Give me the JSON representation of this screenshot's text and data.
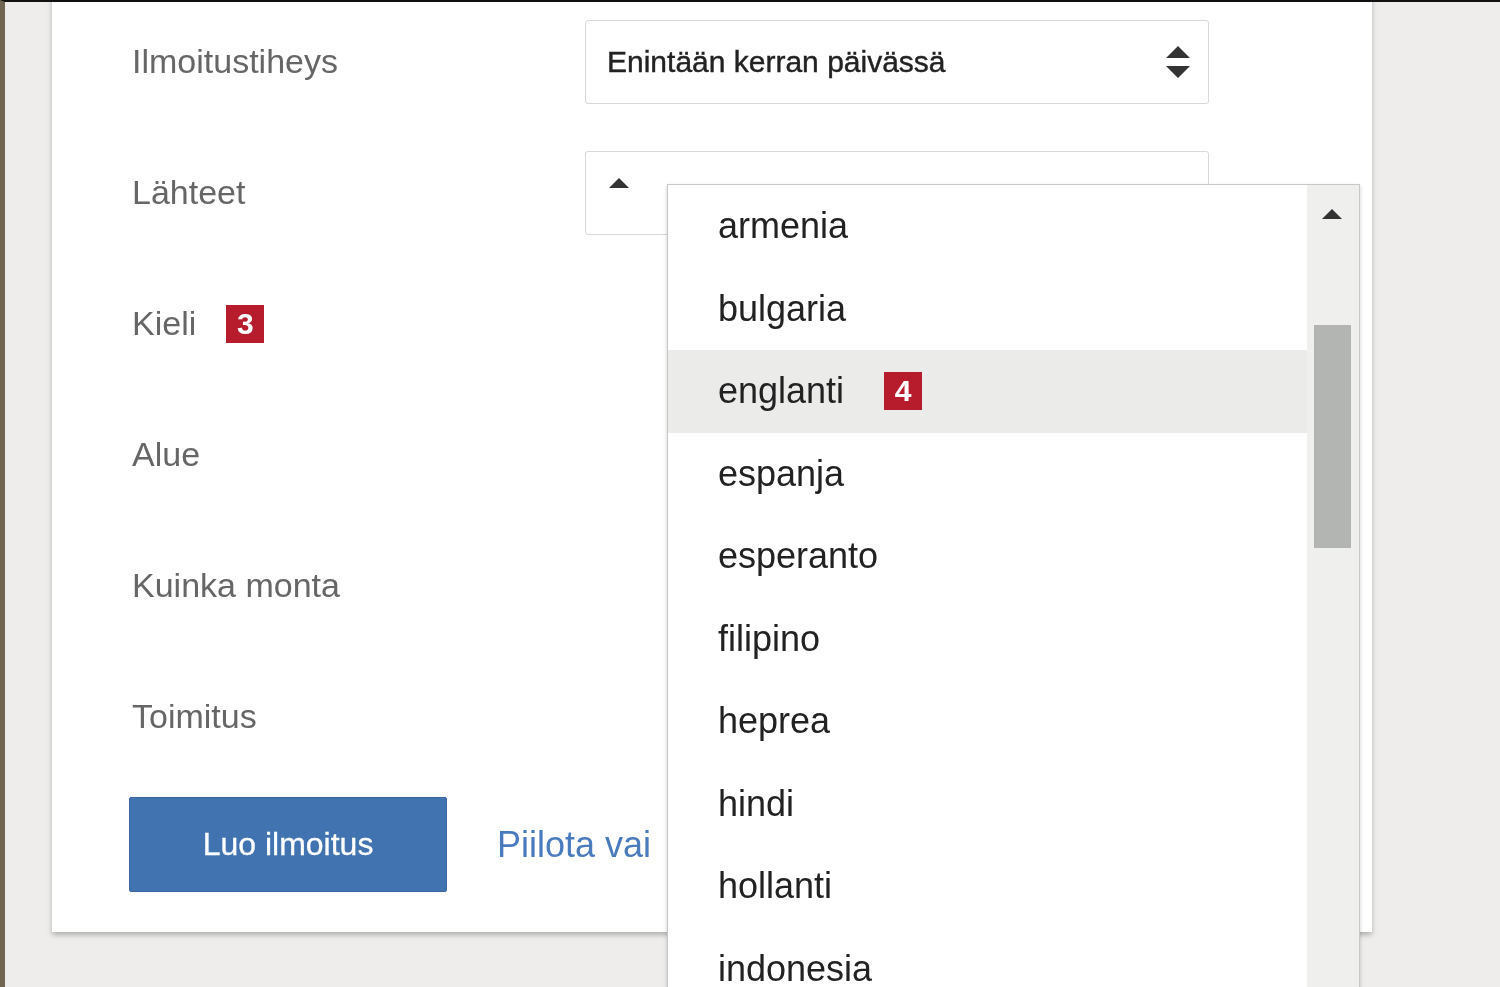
{
  "settings": {
    "rows": [
      {
        "label": "Ilmoitustiheys",
        "kind": "select",
        "value": "Enintään kerran päivässä"
      },
      {
        "label": "Lähteet",
        "kind": "select"
      },
      {
        "label": "Kieli",
        "kind": "plain",
        "badge": "3"
      },
      {
        "label": "Alue",
        "kind": "plain"
      },
      {
        "label": "Kuinka monta",
        "kind": "plain"
      },
      {
        "label": "Toimitus",
        "kind": "plain"
      }
    ],
    "create_button": "Luo ilmoitus",
    "options_link": "Piilota vai"
  },
  "language_dropdown": {
    "items": [
      {
        "label": "armenia",
        "selected": false
      },
      {
        "label": "bulgaria",
        "selected": false
      },
      {
        "label": "englanti",
        "selected": true,
        "badge": "4"
      },
      {
        "label": "espanja",
        "selected": false
      },
      {
        "label": "esperanto",
        "selected": false
      },
      {
        "label": "filipino",
        "selected": false
      },
      {
        "label": "heprea",
        "selected": false
      },
      {
        "label": "hindi",
        "selected": false
      },
      {
        "label": "hollanti",
        "selected": false
      },
      {
        "label": "indonesia",
        "selected": false
      }
    ]
  }
}
